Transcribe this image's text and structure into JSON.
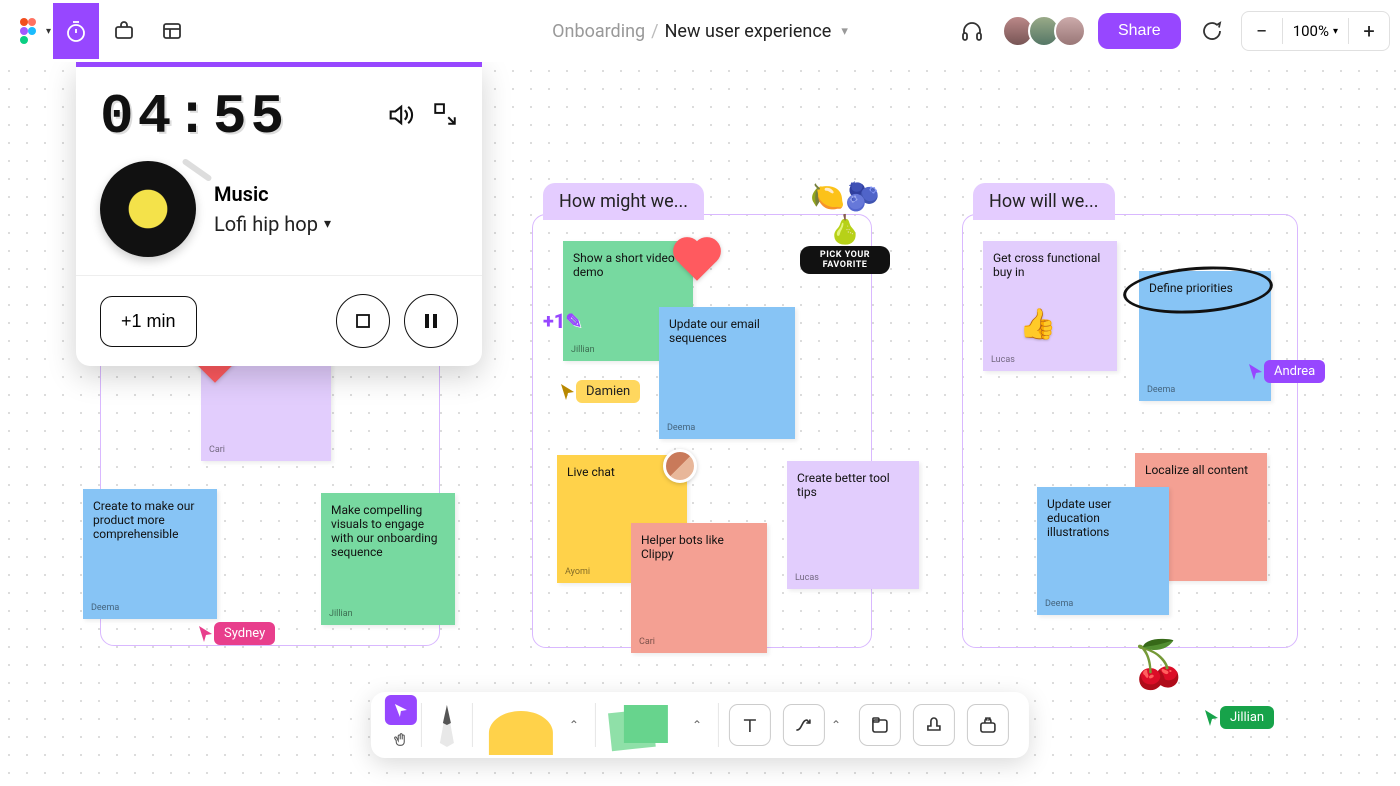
{
  "header": {
    "breadcrumb_parent": "Onboarding",
    "breadcrumb_sep": "/",
    "breadcrumb_current": "New user experience",
    "share_label": "Share",
    "zoom_value": "100%"
  },
  "timer": {
    "time_display": "04:55",
    "music_heading": "Music",
    "music_selection": "Lofi hip hop",
    "plus_one_label": "+1 min"
  },
  "sections": {
    "a": {
      "label": ""
    },
    "b": {
      "label": "How might we..."
    },
    "c": {
      "label": "How will we..."
    }
  },
  "notes": {
    "a1": {
      "text": "",
      "author": "Cari"
    },
    "a2": {
      "text": "Create to make our product more comprehensible",
      "author": "Deema"
    },
    "a3": {
      "text": "Make compelling visuals to engage with our onboarding sequence",
      "author": "Jillian"
    },
    "b1": {
      "text": "Show a short video demo",
      "author": "Jillian"
    },
    "b2": {
      "text": "Update our email sequences",
      "author": "Deema"
    },
    "b3": {
      "text": "Live chat",
      "author": "Ayomi"
    },
    "b4": {
      "text": "Helper bots like Clippy",
      "author": "Cari"
    },
    "b5": {
      "text": "Create better tool tips",
      "author": "Lucas"
    },
    "c1": {
      "text": "Get cross functional buy in",
      "author": "Lucas"
    },
    "c2": {
      "text": "Define priorities",
      "author": "Deema"
    },
    "c3": {
      "text": "Update user education illustrations",
      "author": "Deema"
    },
    "c4": {
      "text": "Localize all content",
      "author": ""
    }
  },
  "cursors": {
    "sydney": "Sydney",
    "damien": "Damien",
    "andrea": "Andrea",
    "jillian": "Jillian"
  },
  "stickers": {
    "favorite_label": "PICK YOUR FAVORITE"
  }
}
